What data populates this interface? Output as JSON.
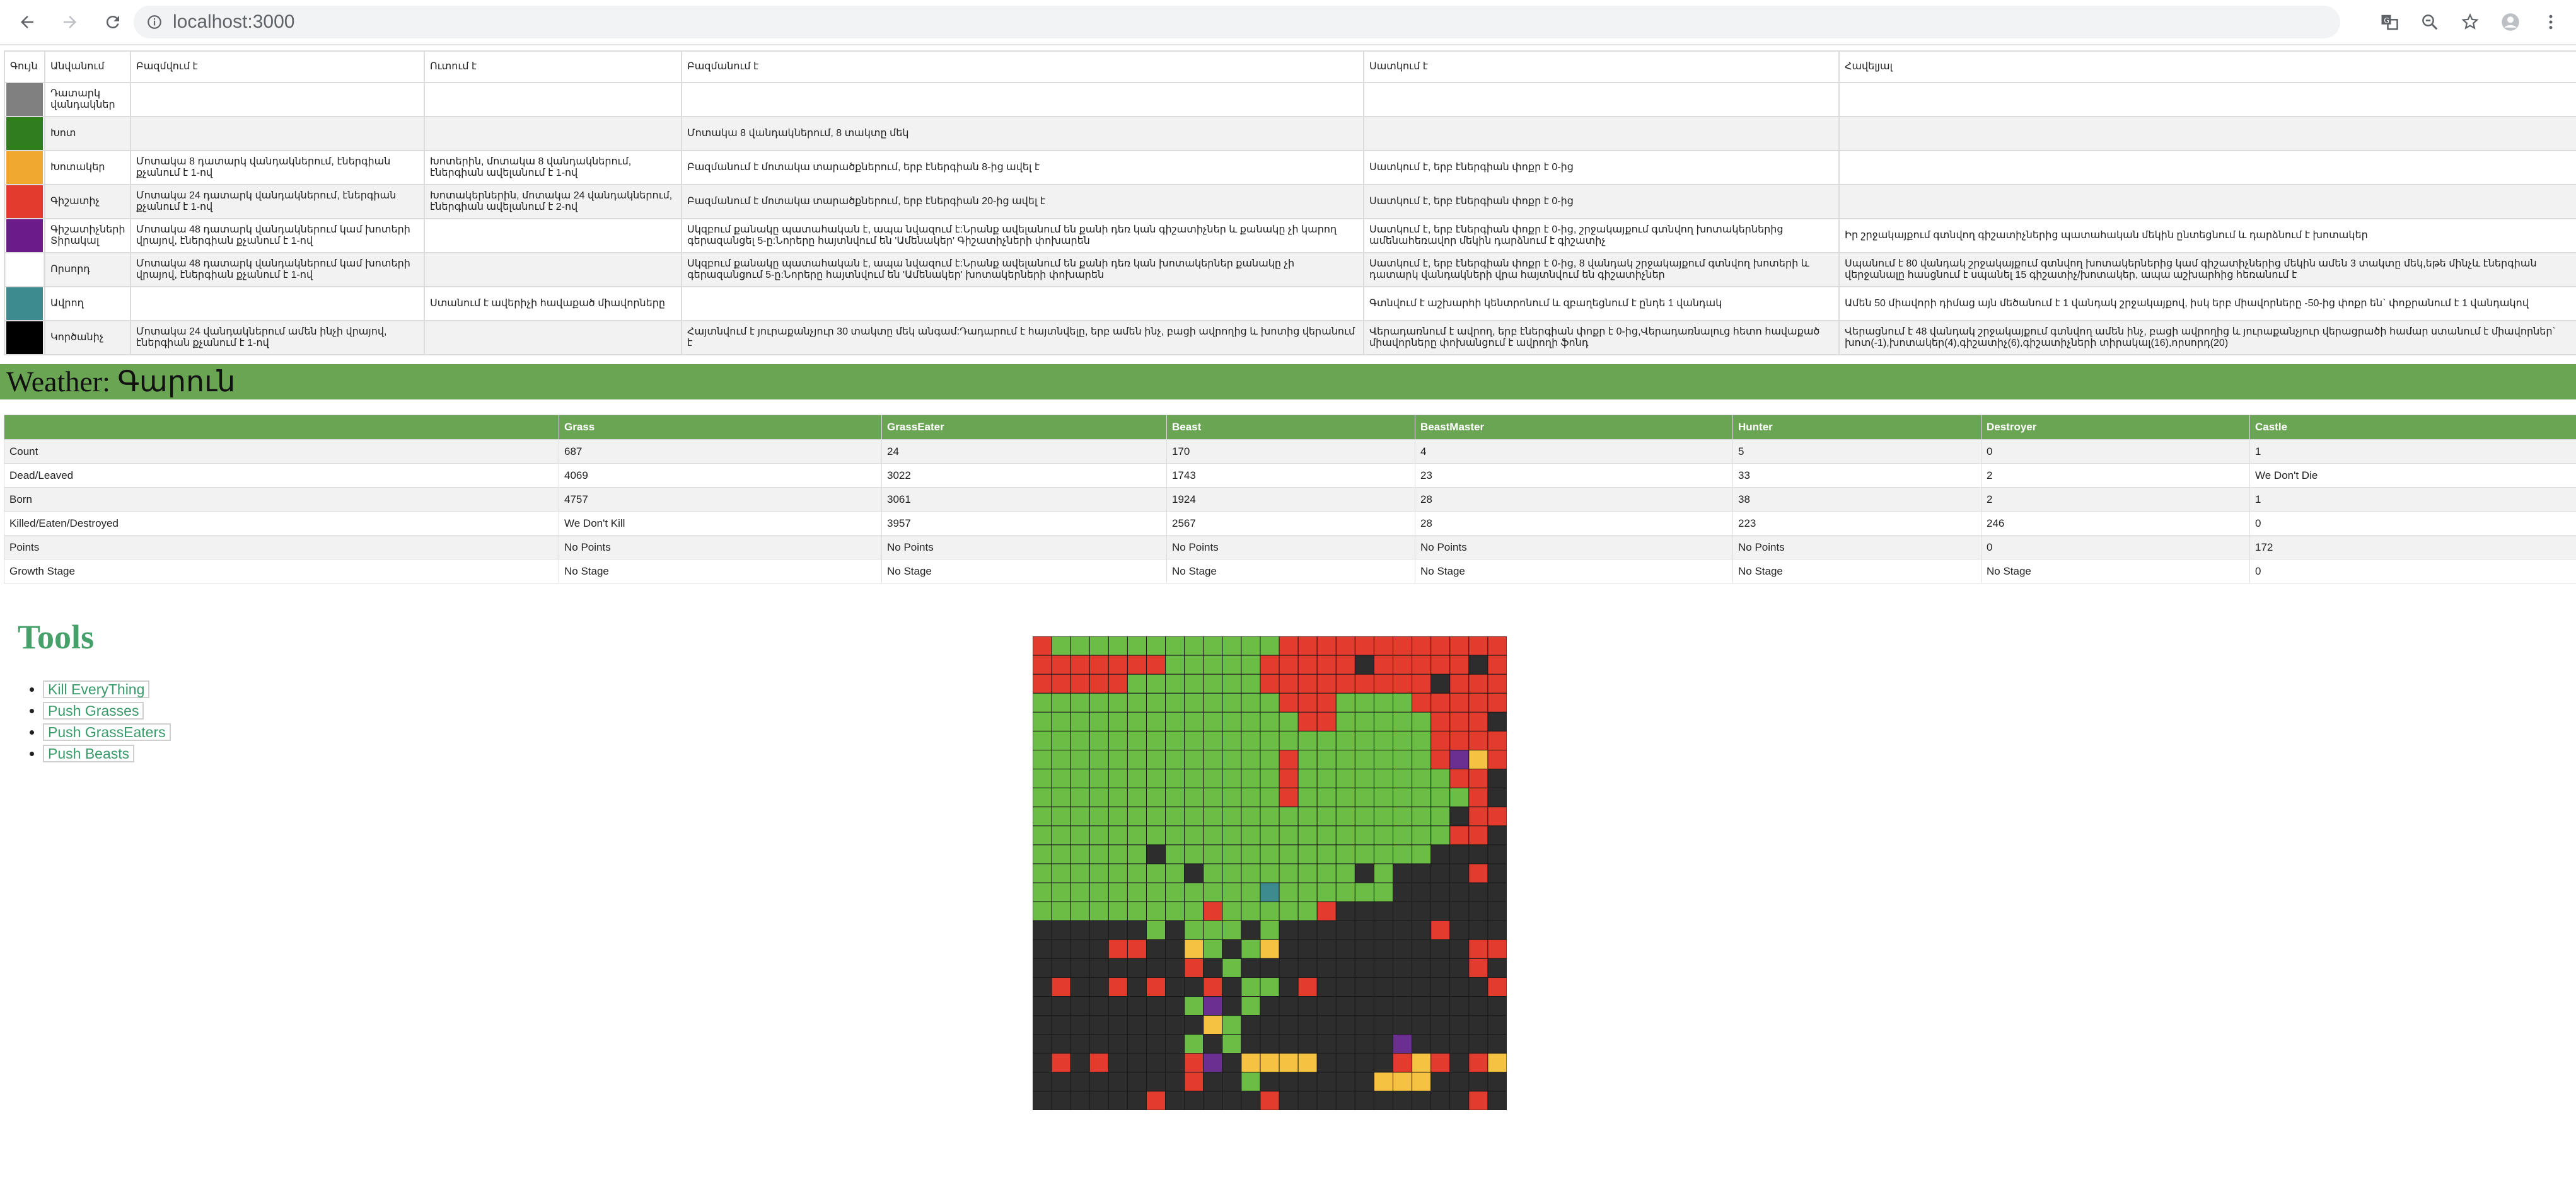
{
  "browser": {
    "url": "localhost:3000",
    "icons": [
      "back-icon",
      "forward-icon",
      "reload-icon",
      "info-icon",
      "translate-icon",
      "zoom-icon",
      "star-icon",
      "profile-icon",
      "menu-icon"
    ]
  },
  "legend": {
    "headers": [
      "Գույն",
      "Անվանում",
      "Բազմվում է",
      "Ուտում է",
      "Բազմանում է",
      "Սատկում է",
      "Հավելյալ"
    ],
    "rows": [
      {
        "color": "#808080",
        "name": "Դատարկ վանդակներ",
        "moves": "",
        "eats": "",
        "multiplies": "",
        "dies": "",
        "extra": ""
      },
      {
        "color": "#2f7d1f",
        "name": "Խոտ",
        "moves": "",
        "eats": "",
        "multiplies": "Մոտակա 8 վանդակներում, 8 տակտը մեկ",
        "dies": "",
        "extra": ""
      },
      {
        "color": "#f0a830",
        "name": "Խոտակեր",
        "moves": "Մոտակա 8 դատարկ վանդակներում, էներգիան քչանում է 1-ով",
        "eats": "Խոտերին, մոտակա 8 վանդակներում, էներգիան ավելանում է 1-ով",
        "multiplies": "Բազմանում է մոտակա տարածքներում, երբ էներգիան 8-ից ավել է",
        "dies": "Սատկում է, երբ էներգիան փոքր է 0-ից",
        "extra": ""
      },
      {
        "color": "#e33b2e",
        "name": "Գիշատիչ",
        "moves": "Մոտակա 24 դատարկ վանդակներում, էներգիան քչանում է 1-ով",
        "eats": "Խոտակերներին, մոտակա 24 վանդակներում, էներգիան ավելանում է 2-ով",
        "multiplies": "Բազմանում է մոտակա տարածքներում, երբ էներգիան 20-ից ավել է",
        "dies": "Սատկում է, երբ էներգիան փոքր է 0-ից",
        "extra": ""
      },
      {
        "color": "#6b1b8a",
        "name": "Գիշատիչների Տիրակալ",
        "moves": "Մոտակա 48 դատարկ վանդակներում կամ խոտերի վրայով, էներգիան քչանում է 1-ով",
        "eats": "",
        "multiplies": "Սկզբում քանակը պատահական է, ապա նվազում է:Նրանք ավելանում են քանի դեռ կան գիշատիչներ և քանակը չի կարող գերազանցել 5-ը:Նորերը հայտնվում են 'Ամենակեր' Գիշատիչների փոխարեն",
        "dies": "Սատկում է, երբ էներգիան փոքր է 0-ից, շրջակայքում գտնվող խոտակերներից ամենահեռավոր մեկին դարձնում է գիշատիչ",
        "extra": "Իր շրջակայքում գտնվող գիշատիչներից պատահական մեկին ընտեցնում և դարձնում է խոտակեր"
      },
      {
        "color": "#ffffff",
        "name": "Որսորդ",
        "moves": "Մոտակա 48 դատարկ վանդակներում կամ խոտերի վրայով, էներգիան քչանում է 1-ով",
        "eats": "",
        "multiplies": "Սկզբում քանակը պատահական է, ապա նվազում է:Նրանք ավելանում են քանի դեռ կան խոտակերներ քանակը չի գերազանցում 5-ը:Նորերը հայտնվում են 'Ամենակեր' խոտակերների փոխարեն",
        "dies": "Սատկում է, երբ էներգիան փոքր է 0-ից, 8 վանդակ շրջակայքում գտնվող խոտերի և դատարկ վանդակների վրա հայտնվում են գիշատիչներ",
        "extra": "Սպանում է 80 վանդակ շրջակայքում գտնվող խոտակերներից կամ գիշատիչներից մեկին ամեն 3 տակտը մեկ,եթե մինչև էներգիան վերջանալը հասցնում է սպանել 15 գիշատիչ/խոտակեր, ապա աշխարհից հեռանում է"
      },
      {
        "color": "#3d8a8f",
        "name": "Ավրող",
        "moves": "",
        "eats": "Ստանում է ավերիչի հավաքած միավորները",
        "multiplies": "",
        "dies": "Գտնվում է աշխարհի կենտրոնում և զբաղեցնում է ընդե 1 վանդակ",
        "extra": "Ամեն 50 միավորի դիմաց այն մեծանում է 1 վանդակ շրջակայքով, իսկ երբ միավորները -50-ից փոքր են` փոքրանում է 1 վանդակով"
      },
      {
        "color": "#000000",
        "name": "Կործանիչ",
        "moves": "Մոտակա 24 վանդակներում ամեն ինչի վրայով, էներգիան քչանում է 1-ով",
        "eats": "",
        "multiplies": "Հայտնվում է յուրաքանչյուր 30 տակտը մեկ անգամ:Դադարում է հայտնվելը, երբ ամեն ինչ, բացի ավրողից և խոտից վերանում է",
        "dies": "Վերադառնում է ավրող, երբ էներգիան փոքր է 0-ից,Վերադառնալուց հետո հավաքած միավորները փոխանցում է ավրողի ֆոնդ",
        "extra": "Վերացնում է 48 վանդակ շրջակայքում գտնվող ամեն ինչ, բացի ավրողից և յուրաքանչյուր վերացրածի համար ստանում է միավորներ` խոտ(-1),խոտակեր(4),գիշատիչ(6),գիշատիչների տիրակալ(16),որսորդ(20)"
      }
    ]
  },
  "weather": {
    "label": "Weather:",
    "value": "Գարուն"
  },
  "stats": {
    "headers": [
      "",
      "Grass",
      "GrassEater",
      "Beast",
      "BeastMaster",
      "Hunter",
      "Destroyer",
      "Castle"
    ],
    "rows": [
      [
        "Count",
        "687",
        "24",
        "170",
        "4",
        "5",
        "0",
        "1"
      ],
      [
        "Dead/Leaved",
        "4069",
        "3022",
        "1743",
        "23",
        "33",
        "2",
        "We Don't Die"
      ],
      [
        "Born",
        "4757",
        "3061",
        "1924",
        "28",
        "38",
        "2",
        "1"
      ],
      [
        "Killed/Eaten/Destroyed",
        "We Don't Kill",
        "3957",
        "2567",
        "28",
        "223",
        "246",
        "0"
      ],
      [
        "Points",
        "No Points",
        "No Points",
        "No Points",
        "No Points",
        "No Points",
        "0",
        "172"
      ],
      [
        "Growth Stage",
        "No Stage",
        "No Stage",
        "No Stage",
        "No Stage",
        "No Stage",
        "No Stage",
        "0"
      ]
    ]
  },
  "tools": {
    "title": "Tools",
    "buttons": [
      "Kill EveryThing",
      "Push Grasses",
      "Push GrassEaters",
      "Push Beasts"
    ]
  },
  "matrix": {
    "size": 25,
    "palette": {
      "0": "#2d2d2d",
      "1": "#6cbd45",
      "2": "#f5c242",
      "3": "#e33b2e",
      "4": "#6b2f92",
      "5": "#e5f5d8",
      "6": "#3d8a8f"
    },
    "rows": [
      "3111111111111333333333333",
      "3333333111113333303333303",
      "3333311111113333333330333",
      "1111111111111333111133333",
      "1111111111111133111113330",
      "1111111111111111111113333",
      "1111111111111311111113423",
      "1111111111111311111111330",
      "1111111111111311111111130",
      "1111111111111111111111033",
      "1111111111111111111111330",
      "1111110111111111111110000",
      "1111111101111111101000030",
      "1111111111116111111000000",
      "1111111113111113000000000",
      "0000001011101000000003000",
      "0000330021012000000000033",
      "0000000030100000000000030",
      "0300303003011030000000003",
      "0000000014010000000000000",
      "0000000002100000000000000",
      "0000000010100000000400000",
      "0303000034022220000323032",
      "0000000030010000002220000",
      "0000003000003000000000030"
    ]
  }
}
